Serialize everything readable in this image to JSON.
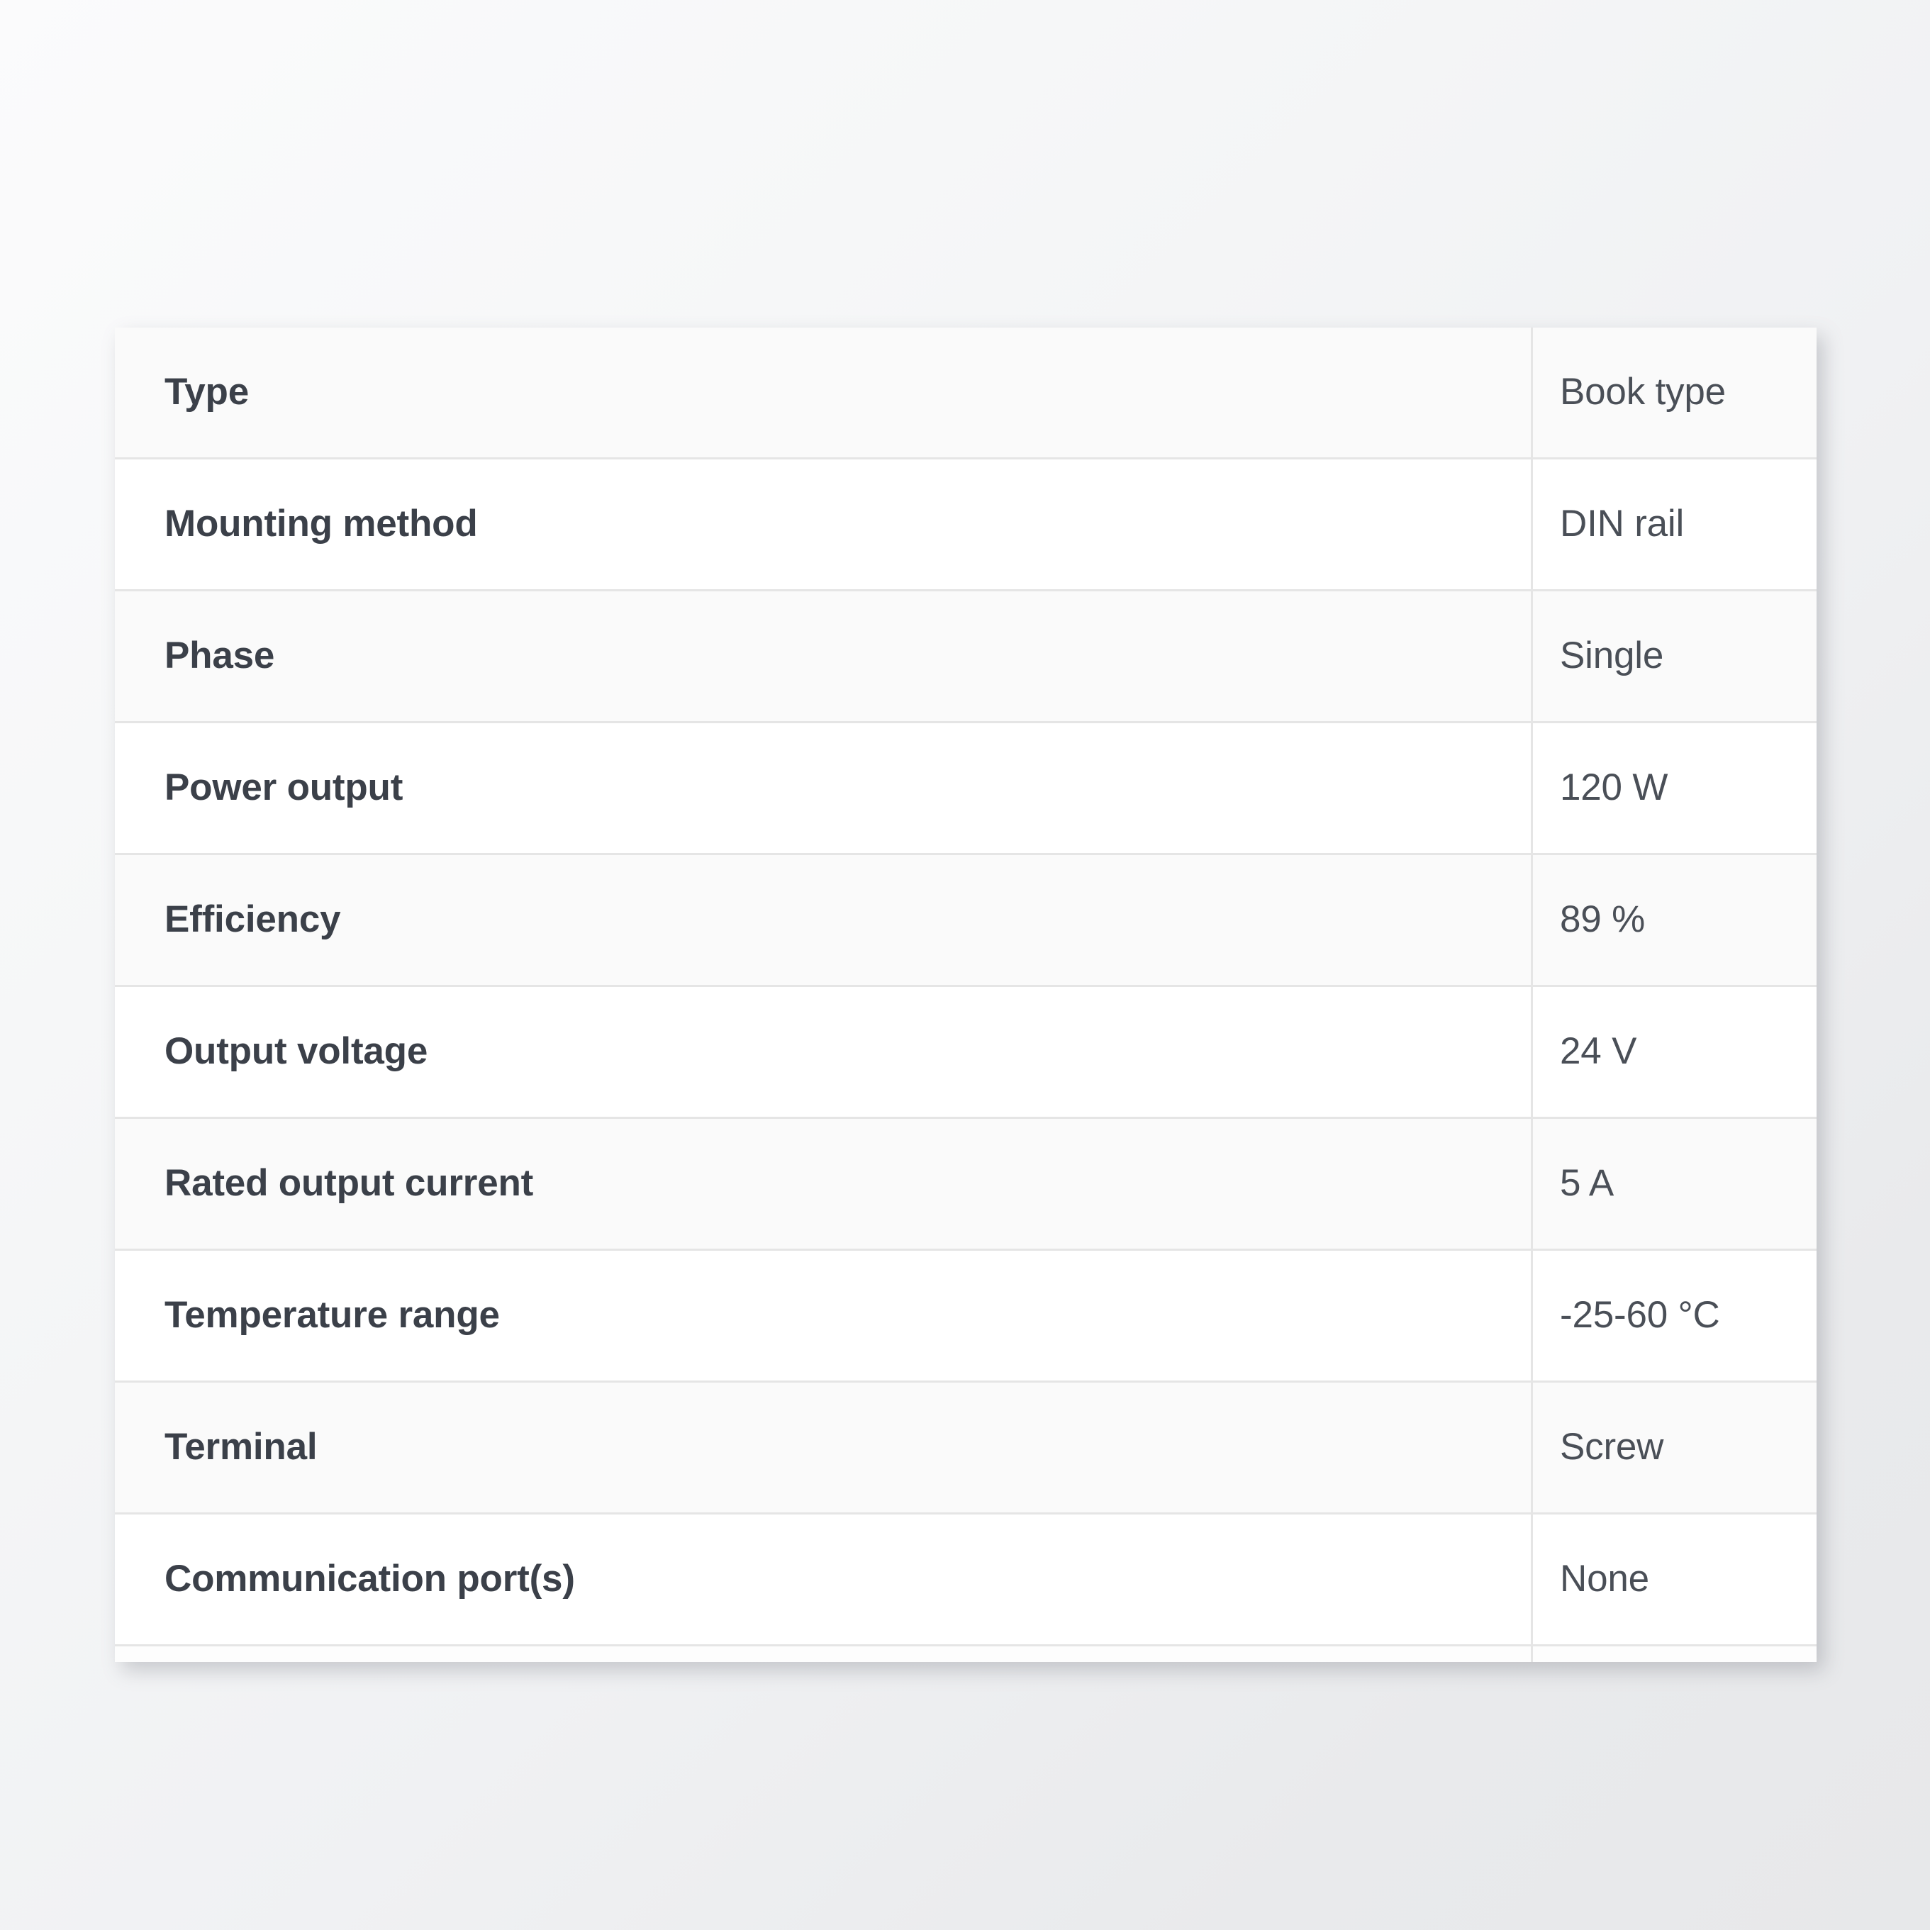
{
  "card": {
    "name": "product-specification-table"
  },
  "table": {
    "rows": [
      {
        "label": "Type",
        "value": "Book type"
      },
      {
        "label": "Mounting method",
        "value": "DIN rail"
      },
      {
        "label": "Phase",
        "value": "Single"
      },
      {
        "label": "Power output",
        "value": "120 W"
      },
      {
        "label": "Efficiency",
        "value": "89 %"
      },
      {
        "label": "Output voltage",
        "value": "24 V"
      },
      {
        "label": "Rated output current",
        "value": "5 A"
      },
      {
        "label": "Temperature range",
        "value": "-25-60 °C"
      },
      {
        "label": "Terminal",
        "value": "Screw"
      },
      {
        "label": "Communication port(s)",
        "value": "None"
      }
    ]
  },
  "colors": {
    "label_text": "#3b4049",
    "value_text": "#4a4f57",
    "row_border": "#e5e5e5",
    "row_stripe": "#fafafa",
    "row_plain": "#ffffff",
    "page_background_light": "#fbfbfc",
    "page_background_dark": "#e7e8ea"
  }
}
